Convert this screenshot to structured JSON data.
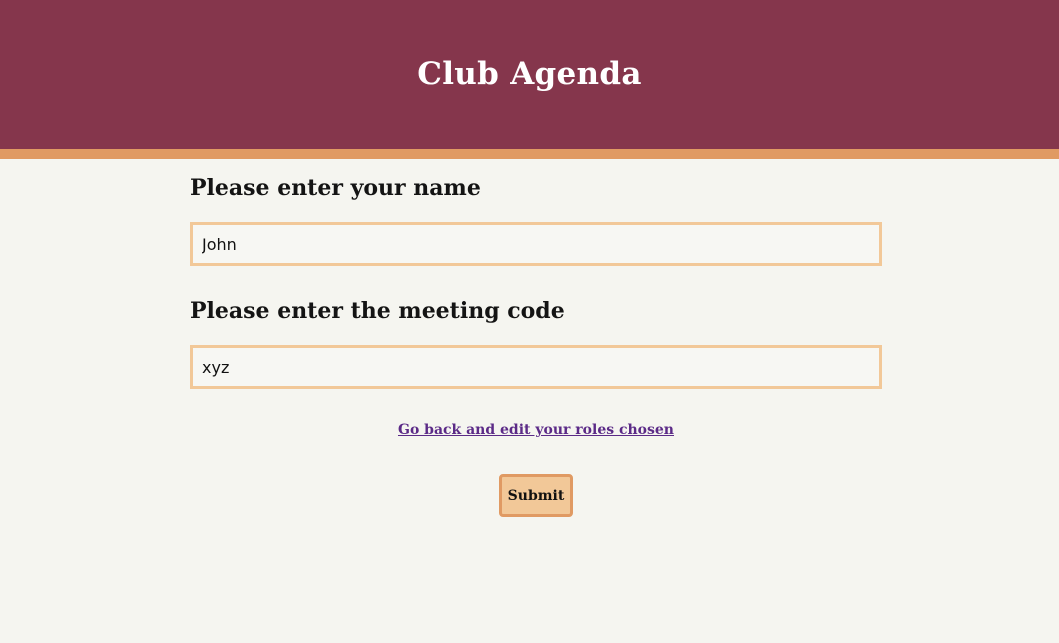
{
  "header": {
    "title": "Club Agenda"
  },
  "form": {
    "name_label": "Please enter your name",
    "name_value": "John",
    "code_label": "Please enter the meeting code",
    "code_value": "xyz",
    "back_link": "Go back and edit your roles chosen",
    "submit_label": "Submit"
  },
  "colors": {
    "header_bg": "#85364c",
    "accent_stripe": "#e09a63",
    "input_border": "#f2c898",
    "link": "#5b2a87",
    "page_bg": "#f5f5f0"
  }
}
